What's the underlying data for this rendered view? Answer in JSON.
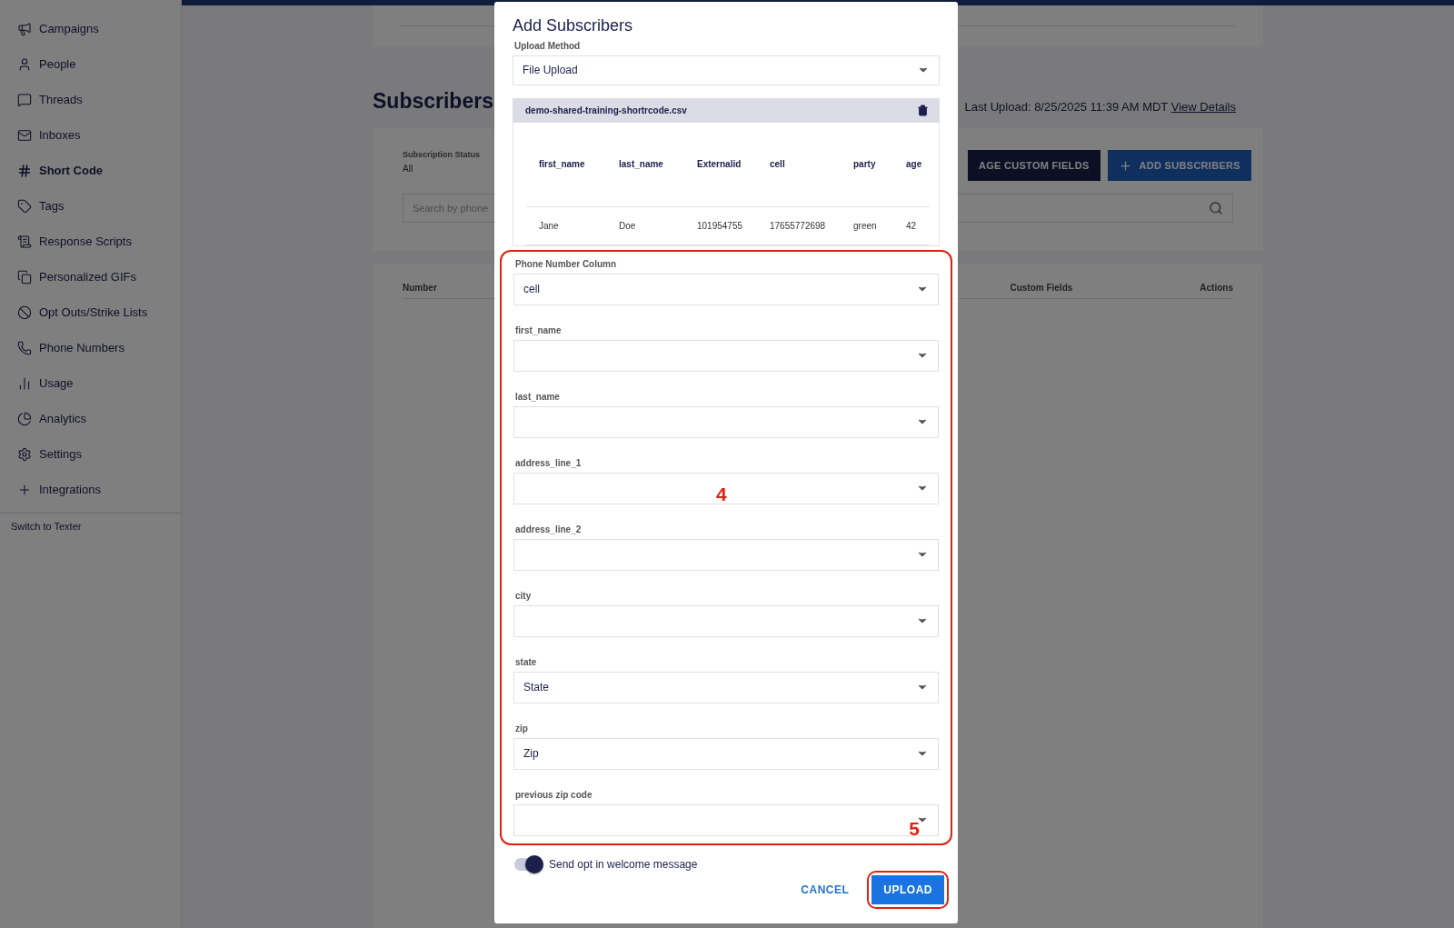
{
  "sidebar": {
    "items": [
      {
        "label": "Campaigns",
        "selected": false
      },
      {
        "label": "People",
        "selected": false
      },
      {
        "label": "Threads",
        "selected": false
      },
      {
        "label": "Inboxes",
        "selected": false
      },
      {
        "label": "Short Code",
        "selected": true
      },
      {
        "label": "Tags",
        "selected": false
      },
      {
        "label": "Response Scripts",
        "selected": false
      },
      {
        "label": "Personalized GIFs",
        "selected": false
      },
      {
        "label": "Opt Outs/Strike Lists",
        "selected": false
      },
      {
        "label": "Phone Numbers",
        "selected": false
      },
      {
        "label": "Usage",
        "selected": false
      },
      {
        "label": "Analytics",
        "selected": false
      },
      {
        "label": "Settings",
        "selected": false
      },
      {
        "label": "Integrations",
        "selected": false
      }
    ],
    "footer_link": "Switch to Texter"
  },
  "page": {
    "title": "Subscribers",
    "last_upload": "Last Upload: 8/25/2025 11:39 AM MDT",
    "view_details": "View Details",
    "filter": {
      "label": "Subscription Status",
      "value": "All"
    },
    "buttons": [
      {
        "label": "AGE CUSTOM FIELDS",
        "kind": "dark"
      },
      {
        "label": "ADD SUBSCRIBERS",
        "kind": "primary"
      }
    ],
    "search": {
      "placeholder": "Search by phone"
    },
    "table": {
      "columns": [
        "Number",
        "Custom Fields",
        "Actions"
      ]
    }
  },
  "dialog": {
    "title": "Add Subscribers",
    "upload_method": {
      "label": "Upload Method",
      "value": "File Upload"
    },
    "file": {
      "name": "demo-shared-training-shortrcode.csv",
      "columns": [
        "first_name",
        "last_name",
        "Externalid",
        "cell",
        "party",
        "age"
      ],
      "rows": [
        [
          "Jane",
          "Doe",
          "101954755",
          "17655772698",
          "green",
          "42"
        ]
      ]
    },
    "mappings": [
      {
        "label": "Phone Number Column",
        "value": "cell"
      },
      {
        "label": "first_name"
      },
      {
        "label": "last_name"
      },
      {
        "label": "address_line_1"
      },
      {
        "label": "address_line_2"
      },
      {
        "label": "city"
      },
      {
        "label": "state",
        "value": "State"
      },
      {
        "label": "zip",
        "value": "Zip"
      },
      {
        "label": "previous zip code"
      }
    ],
    "toggle": {
      "label": "Send opt in welcome message",
      "on": true
    },
    "cancel": "CANCEL",
    "upload": "UPLOAD"
  },
  "annotations": [
    {
      "label": "4"
    },
    {
      "label": "5"
    }
  ]
}
